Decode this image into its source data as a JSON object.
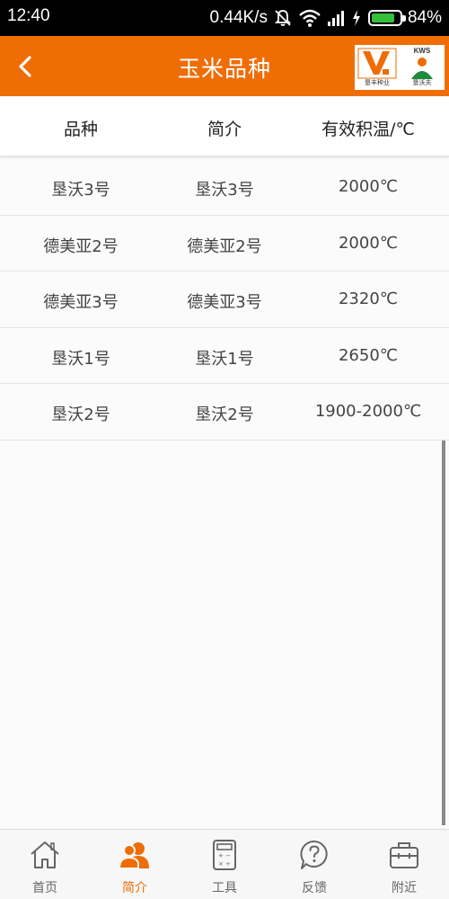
{
  "status_bar": {
    "time": "12:40",
    "speed": "0.44K/s",
    "battery_percent": "84%",
    "battery_level": 0.84
  },
  "header": {
    "title": "玉米品种",
    "logo_k_caption": "垦丰种业",
    "logo_kws_text": "KWS",
    "logo_kws_caption": "垦沃夫"
  },
  "colors": {
    "accent": "#ee6d05",
    "nav_inactive": "#666666"
  },
  "table": {
    "headers": [
      "品种",
      "简介",
      "有效积温/℃"
    ],
    "rows": [
      [
        "垦沃3号",
        "垦沃3号",
        "2000℃"
      ],
      [
        "德美亚2号",
        "德美亚2号",
        "2000℃"
      ],
      [
        "德美亚3号",
        "德美亚3号",
        "2320℃"
      ],
      [
        "垦沃1号",
        "垦沃1号",
        "2650℃"
      ],
      [
        "垦沃2号",
        "垦沃2号",
        "1900-2000℃"
      ]
    ]
  },
  "nav": [
    {
      "label": "首页",
      "icon": "home-icon",
      "active": false
    },
    {
      "label": "简介",
      "icon": "users-icon",
      "active": true
    },
    {
      "label": "工具",
      "icon": "calculator-icon",
      "active": false
    },
    {
      "label": "反馈",
      "icon": "question-icon",
      "active": false
    },
    {
      "label": "附近",
      "icon": "briefcase-icon",
      "active": false
    }
  ]
}
